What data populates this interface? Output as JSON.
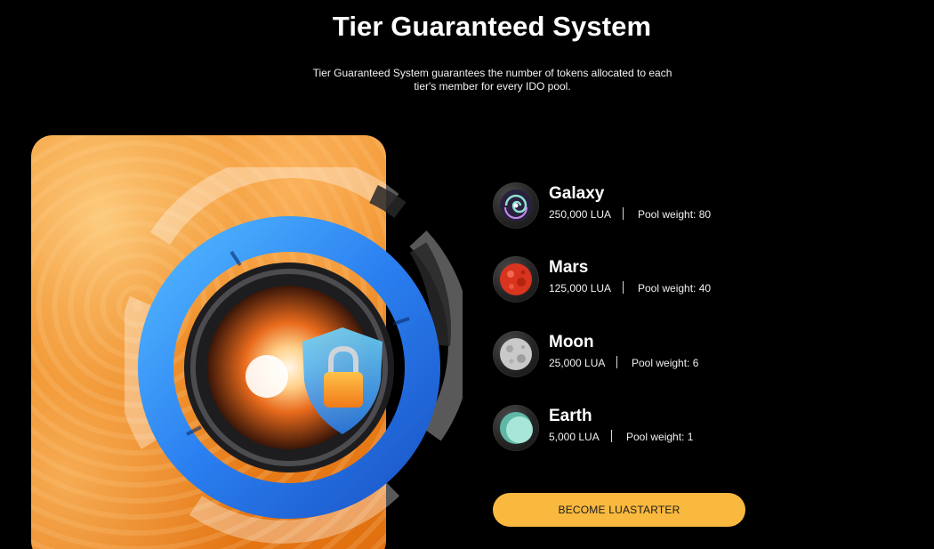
{
  "header": {
    "title": "Tier Guaranteed System",
    "subtitle": "Tier Guaranteed System guarantees the number of tokens allocated to each tier's member for every IDO pool."
  },
  "hero": {
    "image": "shield-lock-vault-illustration",
    "background_color": "#ee8a23"
  },
  "tiers": [
    {
      "name": "Galaxy",
      "amount": "250,000 LUA",
      "weight": "Pool weight: 80",
      "icon": "galaxy-icon",
      "color": "#7fd6c8"
    },
    {
      "name": "Mars",
      "amount": "125,000 LUA",
      "weight": "Pool weight: 40",
      "icon": "mars-icon",
      "color": "#e8452c"
    },
    {
      "name": "Moon",
      "amount": "25,000 LUA",
      "weight": "Pool weight: 6",
      "icon": "moon-icon",
      "color": "#cfcfcf"
    },
    {
      "name": "Earth",
      "amount": "5,000 LUA",
      "weight": "Pool weight: 1",
      "icon": "earth-icon",
      "color": "#8fd5c5"
    }
  ],
  "cta": {
    "label": "BECOME LUASTARTER",
    "color": "#f9b93f"
  }
}
